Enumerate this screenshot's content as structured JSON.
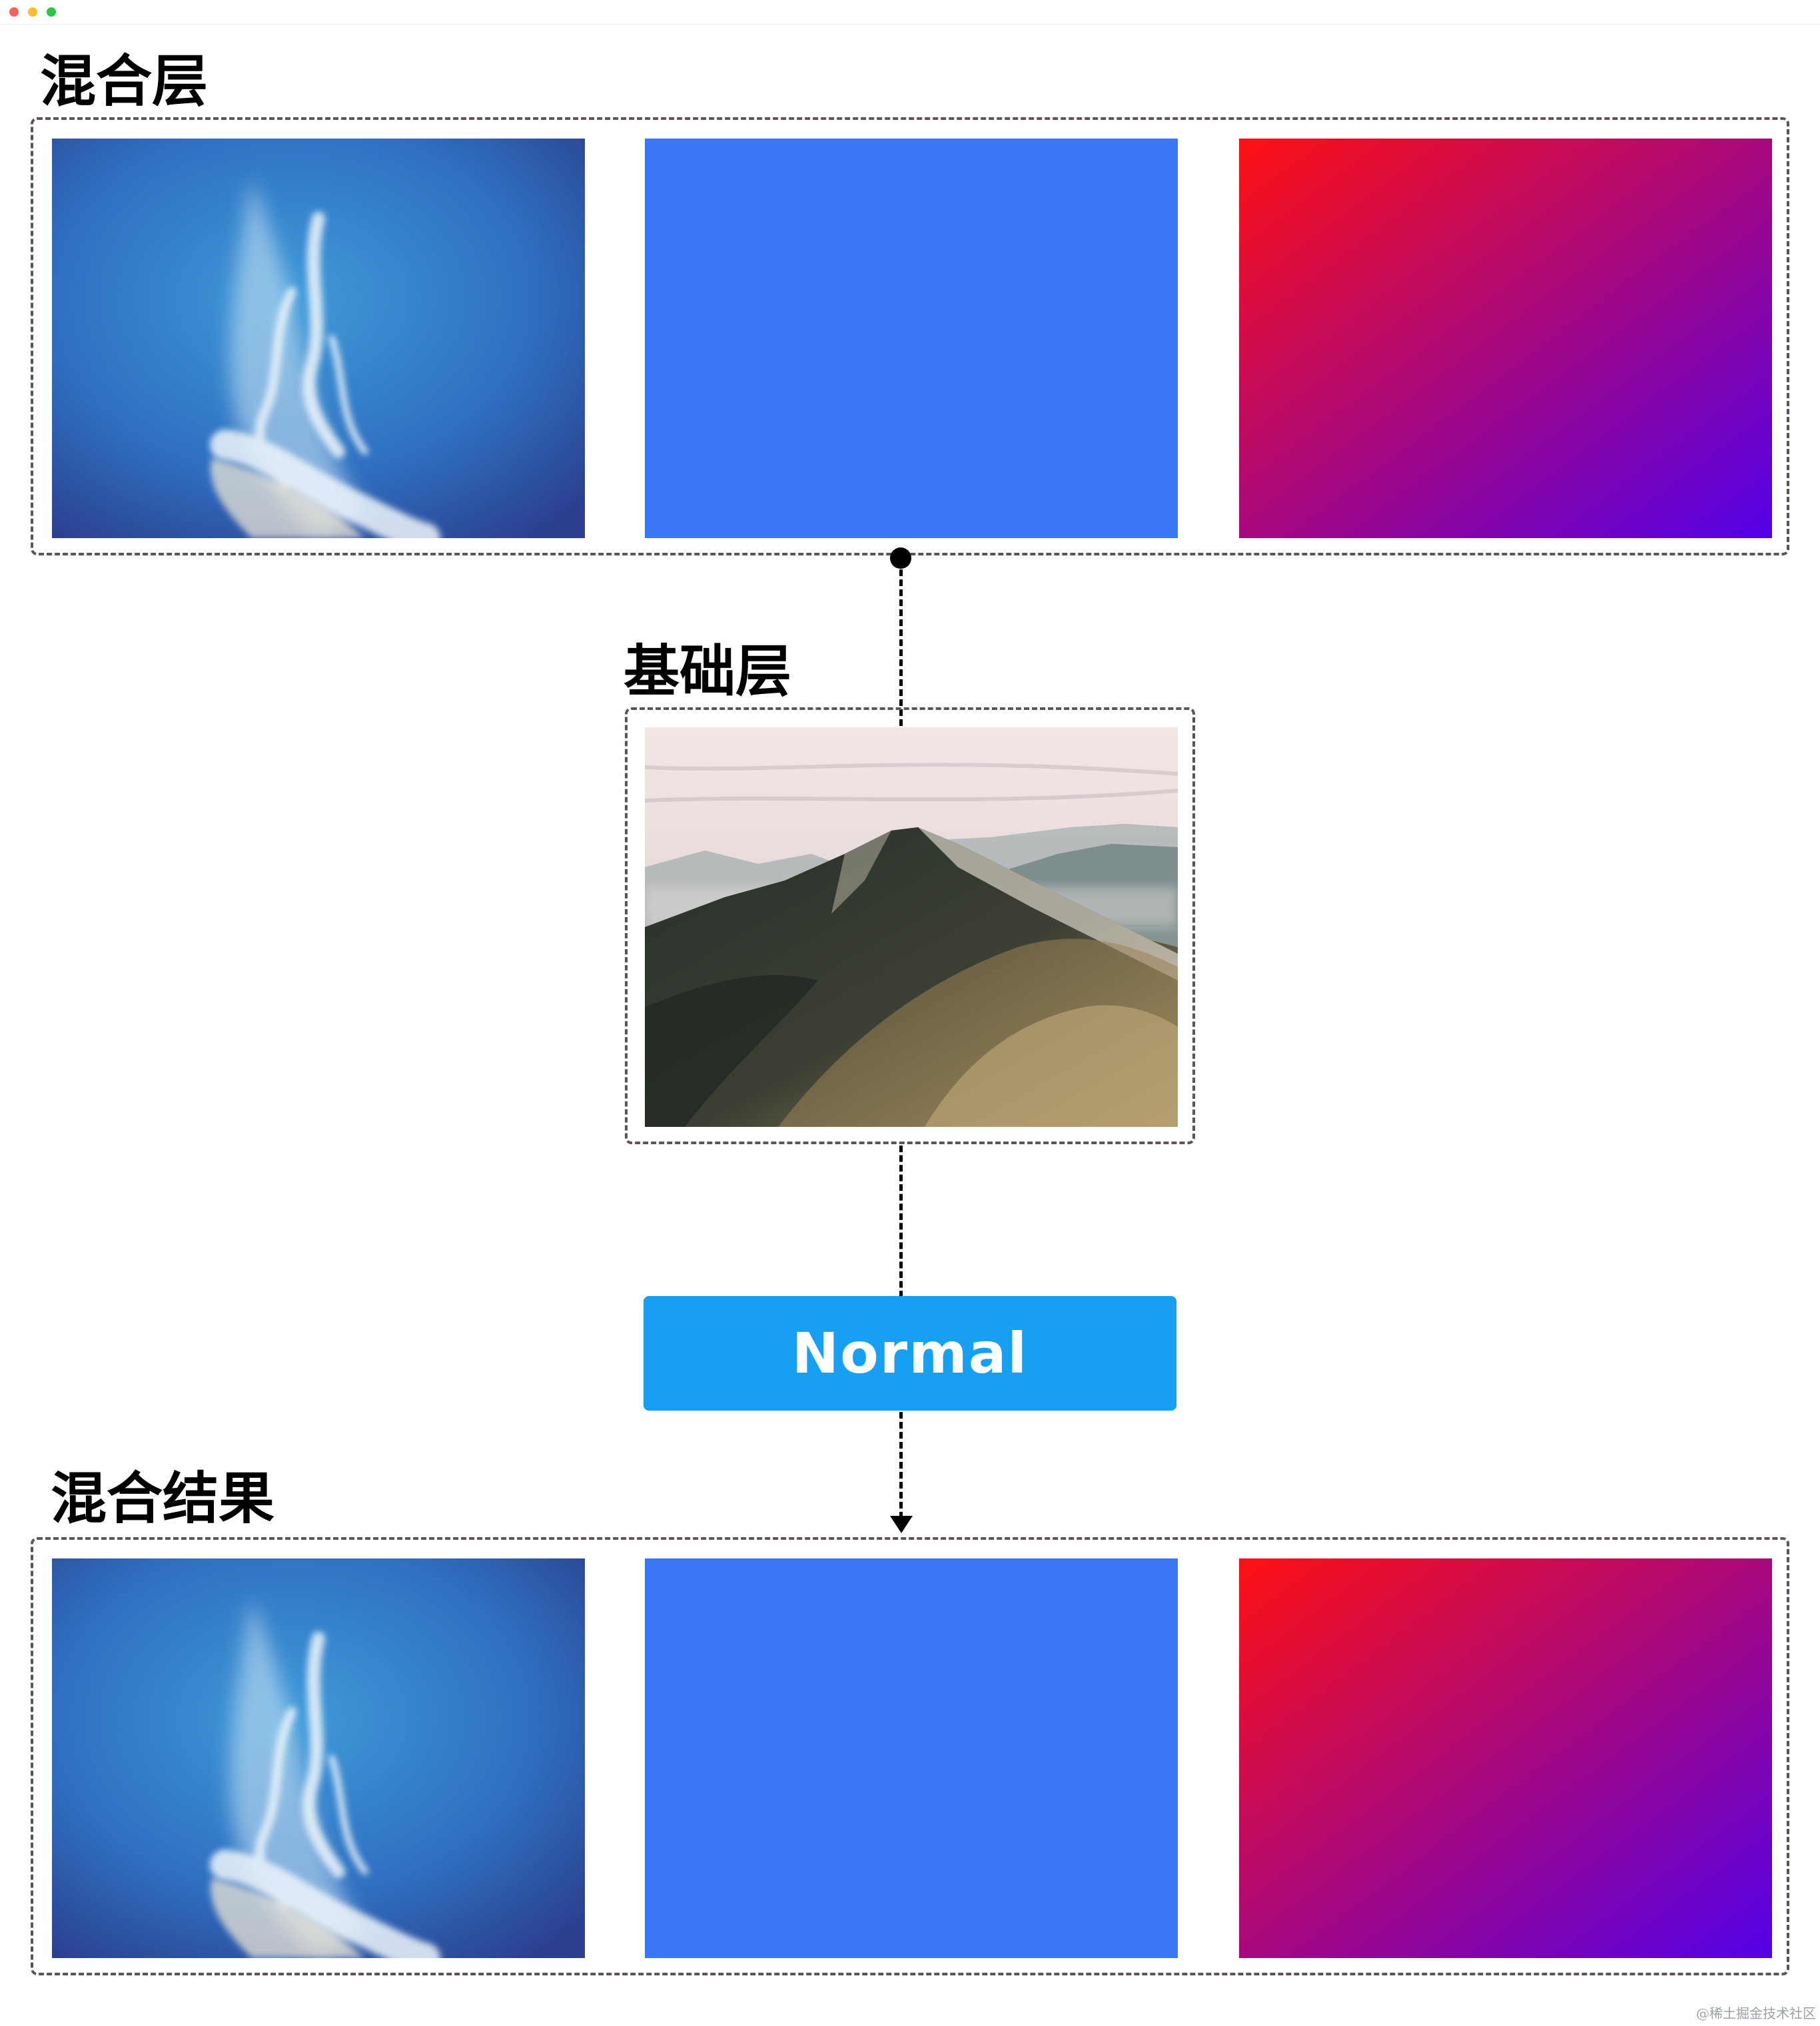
{
  "blend_layer": {
    "title": "混合层",
    "items": [
      "sky-cloud-photo",
      "solid-blue",
      "red-purple-gradient"
    ]
  },
  "base_layer": {
    "title": "基础层",
    "image": "mountain-photo"
  },
  "blend_mode": {
    "label": "Normal"
  },
  "result": {
    "title": "混合结果",
    "items": [
      "sky-cloud-photo",
      "solid-blue",
      "red-purple-gradient"
    ]
  },
  "watermark": "@稀土掘金技术社区",
  "colors": {
    "solid_blue": "#3a76f8",
    "gradient_start": "#fe1012",
    "gradient_end": "#5200e8",
    "button": "#17a0f2",
    "dash_border": "#5d5454"
  }
}
